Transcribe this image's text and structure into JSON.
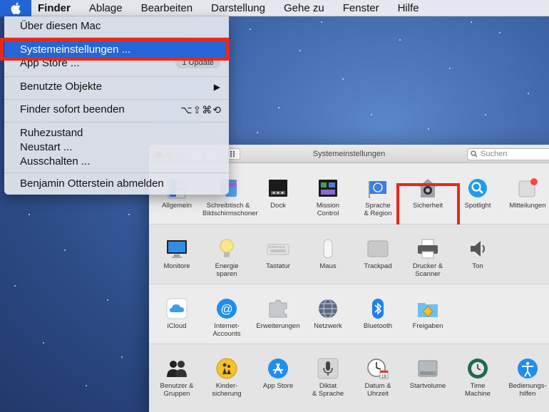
{
  "menubar": {
    "apple": "apple-logo-icon",
    "items": [
      "Finder",
      "Ablage",
      "Bearbeiten",
      "Darstellung",
      "Gehe zu",
      "Fenster",
      "Hilfe"
    ]
  },
  "apple_menu": {
    "about": "Über diesen Mac",
    "system_prefs": "Systemeinstellungen ...",
    "app_store": "App Store ...",
    "app_store_badge": "1 Update",
    "recent": "Benutzte Objekte",
    "recent_arrow": "▶",
    "force_quit": "Finder sofort beenden",
    "force_quit_shortcut": "⌥⇧⌘⟲",
    "sleep": "Ruhezustand",
    "restart": "Neustart ...",
    "shutdown": "Ausschalten ...",
    "logout": "Benjamin Otterstein abmelden"
  },
  "window": {
    "title": "Systemeinstellungen",
    "search_placeholder": "Suchen",
    "row1": [
      "Allgemein",
      "Schreibtisch &\nBildschirmschoner",
      "Dock",
      "Mission\nControl",
      "Sprache\n& Region",
      "Sicherheit",
      "Spotlight",
      "Mitteilungen"
    ],
    "row2": [
      "Monitore",
      "Energie\nsparen",
      "Tastatur",
      "Maus",
      "Trackpad",
      "Drucker &\nScanner",
      "Ton"
    ],
    "row3": [
      "iCloud",
      "Internet-\nAccounts",
      "Erweiterungen",
      "Netzwerk",
      "Bluetooth",
      "Freigaben"
    ],
    "row4": [
      "Benutzer &\nGruppen",
      "Kinder-\nsicherung",
      "App Store",
      "Diktat\n& Sprache",
      "Datum &\nUhrzeit",
      "Startvolume",
      "Time\nMachine",
      "Bedienungs-\nhilfen"
    ]
  },
  "colors": {
    "selection": "#2466d8",
    "highlight": "#e8281a"
  }
}
